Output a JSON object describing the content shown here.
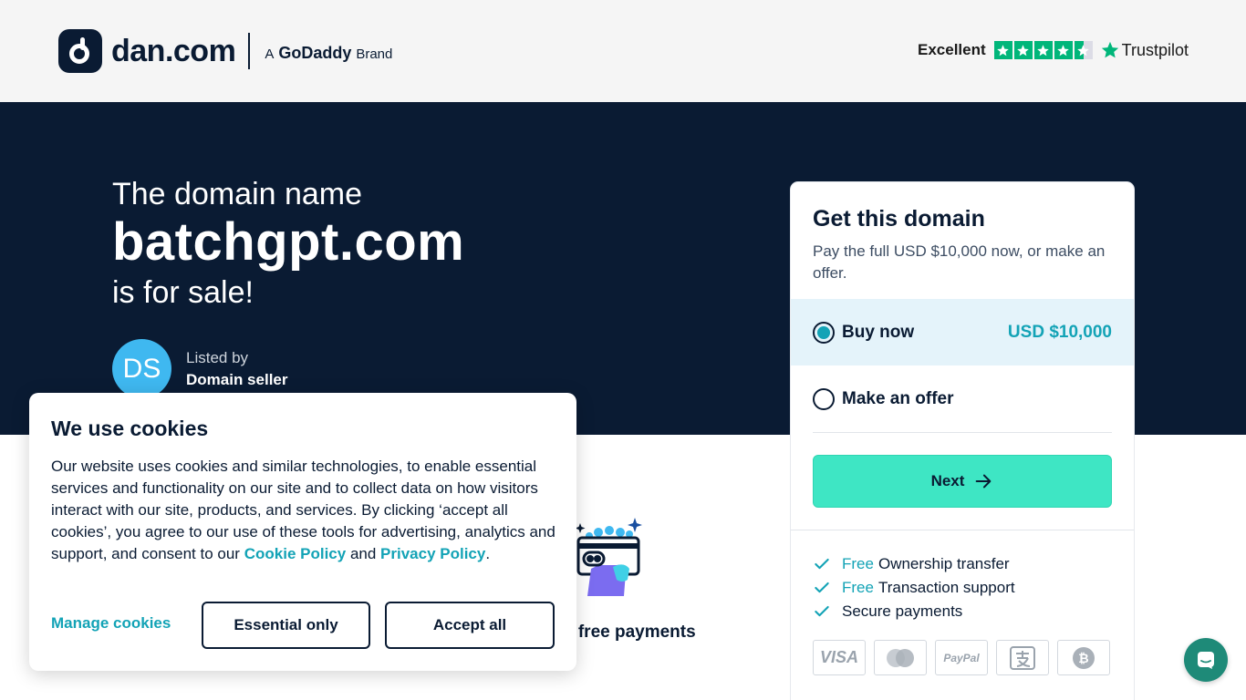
{
  "header": {
    "logo_text": "dan.com",
    "brand_prefix": "A",
    "brand_name": "GoDaddy",
    "brand_suffix": "Brand",
    "trustpilot_rating_label": "Excellent",
    "trustpilot_label": "Trustpilot",
    "trustpilot_stars": 4.5
  },
  "hero": {
    "line1": "The domain name",
    "domain": "batchgpt.com",
    "line3": "is for sale!",
    "seller_initials": "DS",
    "listed_by_label": "Listed by",
    "seller_name": "Domain seller"
  },
  "feature": {
    "label": "Hassle free payments"
  },
  "card": {
    "title": "Get this domain",
    "subtitle": "Pay the full USD $10,000 now, or make an offer.",
    "options": [
      {
        "label": "Buy now",
        "price": "USD $10,000",
        "selected": true
      },
      {
        "label": "Make an offer",
        "selected": false
      }
    ],
    "next_label": "Next",
    "benefits": [
      {
        "free": "Free",
        "text": "Ownership transfer"
      },
      {
        "free": "Free",
        "text": "Transaction support"
      },
      {
        "free": "",
        "text": "Secure payments"
      }
    ],
    "payment_methods": [
      "VISA",
      "mastercard",
      "PayPal",
      "Alipay",
      "Bitcoin"
    ]
  },
  "cookie": {
    "title": "We use cookies",
    "body": "Our website uses cookies and similar technologies, to enable essential services and functionality on our site and to collect data on how visitors interact with our site, products, and services. By clicking ‘accept all cookies’, you agree to our use of these tools for advertising, analytics and support, and consent to our",
    "cookie_policy_link": "Cookie Policy",
    "and": "and",
    "privacy_policy_link": "Privacy Policy",
    "period": ".",
    "manage_label": "Manage cookies",
    "essential_label": "Essential only",
    "accept_label": "Accept all"
  },
  "colors": {
    "navy": "#0a1b33",
    "teal": "#13a3b6",
    "mint": "#3ee6c4",
    "trustpilot_green": "#00b67a",
    "avatar_blue": "#3fb8f0"
  },
  "icons": {
    "chat": "chat-bubble-icon",
    "next": "arrow-right-icon",
    "check": "check-icon"
  }
}
